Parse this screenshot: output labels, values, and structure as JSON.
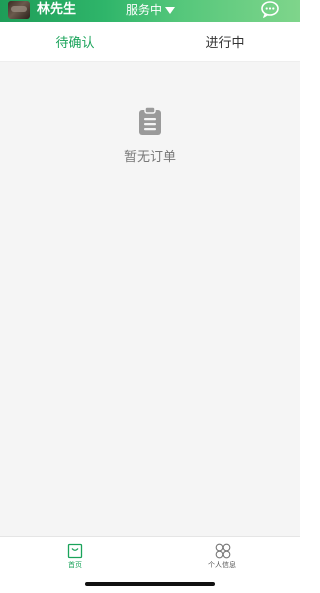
{
  "header": {
    "driver_name": "林先生",
    "status": "服务中",
    "gradient_colors": [
      "#1e9d58",
      "#2fb56a",
      "#55c77b",
      "#7fd58b"
    ]
  },
  "tabs": [
    {
      "label": "待确认",
      "active": true
    },
    {
      "label": "进行中",
      "active": false
    }
  ],
  "empty_state": {
    "text": "暂无订单",
    "icon": "clipboard-icon"
  },
  "bottom_nav": [
    {
      "label": "首页",
      "icon": "bag-icon",
      "active": true
    },
    {
      "label": "个人信息",
      "icon": "grid-petal-icon",
      "active": false
    }
  ],
  "colors": {
    "accent": "#1aa35a",
    "background": "#f5f5f5",
    "empty_text": "#777777"
  }
}
